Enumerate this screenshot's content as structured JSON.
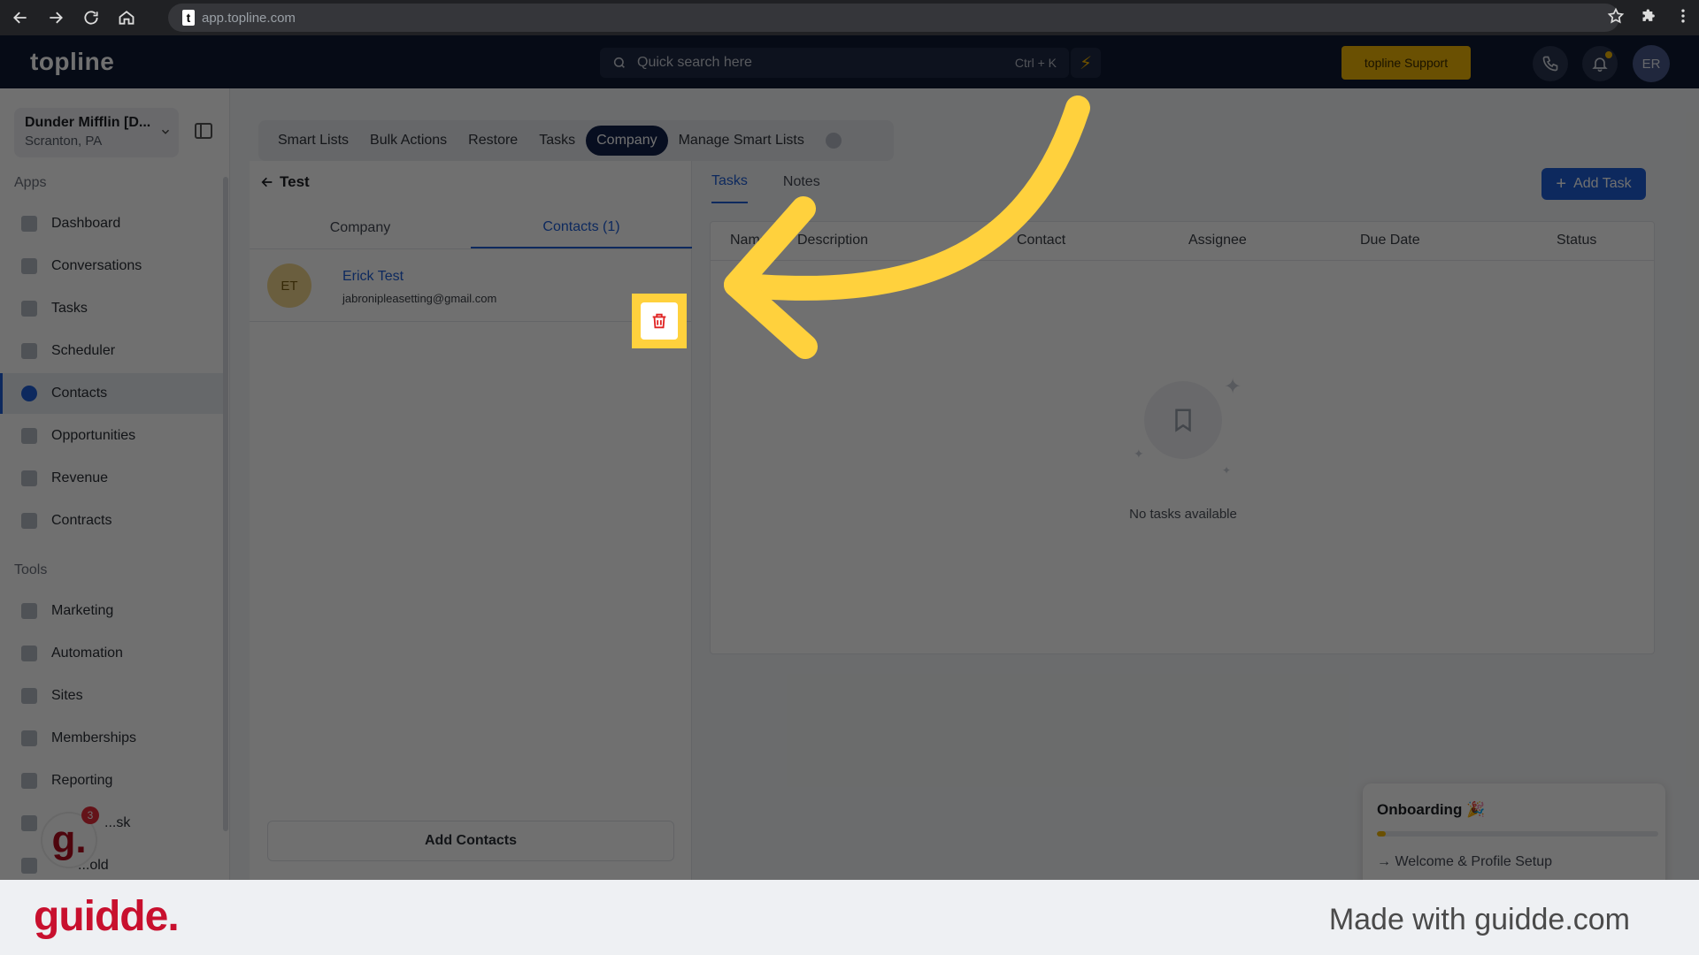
{
  "browser": {
    "url": "app.topline.com"
  },
  "topbar": {
    "logo": "topline",
    "search_placeholder": "Quick search here",
    "search_shortcut": "Ctrl + K",
    "support_label": "topline Support",
    "user_initials": "ER"
  },
  "sidebar": {
    "location_name": "Dunder Mifflin [D...",
    "location_sub": "Scranton, PA",
    "apps_label": "Apps",
    "apps": [
      "Dashboard",
      "Conversations",
      "Tasks",
      "Scheduler",
      "Contacts",
      "Opportunities",
      "Revenue",
      "Contracts"
    ],
    "active_item": "Contacts",
    "tools_label": "Tools",
    "tools": [
      "Marketing",
      "Automation",
      "Sites",
      "Memberships",
      "Reporting",
      "...sk",
      "...old"
    ],
    "guidde_badge_letter": "g.",
    "guidde_badge_count": "3"
  },
  "top_tabs": {
    "items": [
      "Smart Lists",
      "Bulk Actions",
      "Restore",
      "Tasks",
      "Company",
      "Manage Smart Lists"
    ],
    "active": "Company"
  },
  "left_panel": {
    "back_title": "Test",
    "tab_company": "Company",
    "tab_contacts": "Contacts (1)",
    "contact": {
      "initials": "ET",
      "name": "Erick Test",
      "email": "jabronipleasetting@gmail.com"
    },
    "add_contacts_label": "Add Contacts"
  },
  "right_panel": {
    "tab_tasks": "Tasks",
    "tab_notes": "Notes",
    "add_task_label": "Add Task",
    "columns": [
      "Name",
      "Description",
      "Contact",
      "Assignee",
      "Due Date",
      "Status"
    ],
    "empty_text": "No tasks available"
  },
  "onboarding": {
    "title": "Onboarding",
    "progress_fraction": 0.03,
    "step": "Welcome & Profile Setup"
  },
  "colors": {
    "highlight": "#ffd13d",
    "arrow": "#ffd13d",
    "brand_red": "#c8102e",
    "accent_blue": "#1f5fd6",
    "delete_red": "#e02424"
  },
  "footer": {
    "logo": "guidde.",
    "made_with": "Made with guidde.com"
  }
}
